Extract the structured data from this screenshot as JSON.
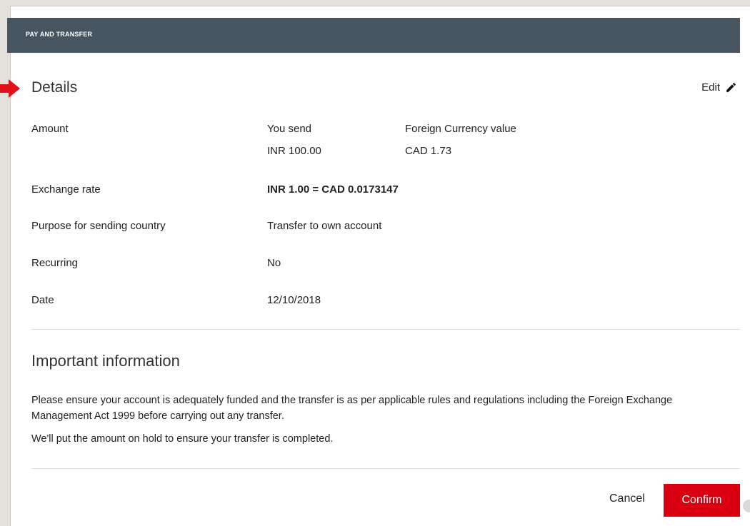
{
  "header": {
    "title": "PAY AND TRANSFER"
  },
  "details": {
    "heading": "Details",
    "edit_label": "Edit",
    "rows": {
      "amount": {
        "label": "Amount",
        "you_send_label": "You send",
        "you_send_value": "INR 100.00",
        "foreign_label": "Foreign Currency value",
        "foreign_value": "CAD 1.73"
      },
      "exchange_rate": {
        "label": "Exchange rate",
        "value": "INR 1.00 = CAD 0.0173147"
      },
      "purpose": {
        "label": "Purpose for sending country",
        "value": "Transfer to own account"
      },
      "recurring": {
        "label": "Recurring",
        "value": "No"
      },
      "date": {
        "label": "Date",
        "value": "12/10/2018"
      }
    }
  },
  "important": {
    "heading": "Important information",
    "paragraph1": "Please ensure your account is adequately funded and the transfer is as per applicable rules and regulations including the Foreign Exchange Management Act 1999 before carrying out any transfer.",
    "paragraph2": "We'll put the amount on hold to ensure your transfer is completed."
  },
  "actions": {
    "cancel_label": "Cancel",
    "confirm_label": "Confirm"
  },
  "colors": {
    "header_bg": "#465560",
    "confirm_bg": "#db0011",
    "arrow": "#e2101b"
  },
  "icons": {
    "edit": "pencil-icon",
    "pointer": "arrow-pointer-icon"
  }
}
